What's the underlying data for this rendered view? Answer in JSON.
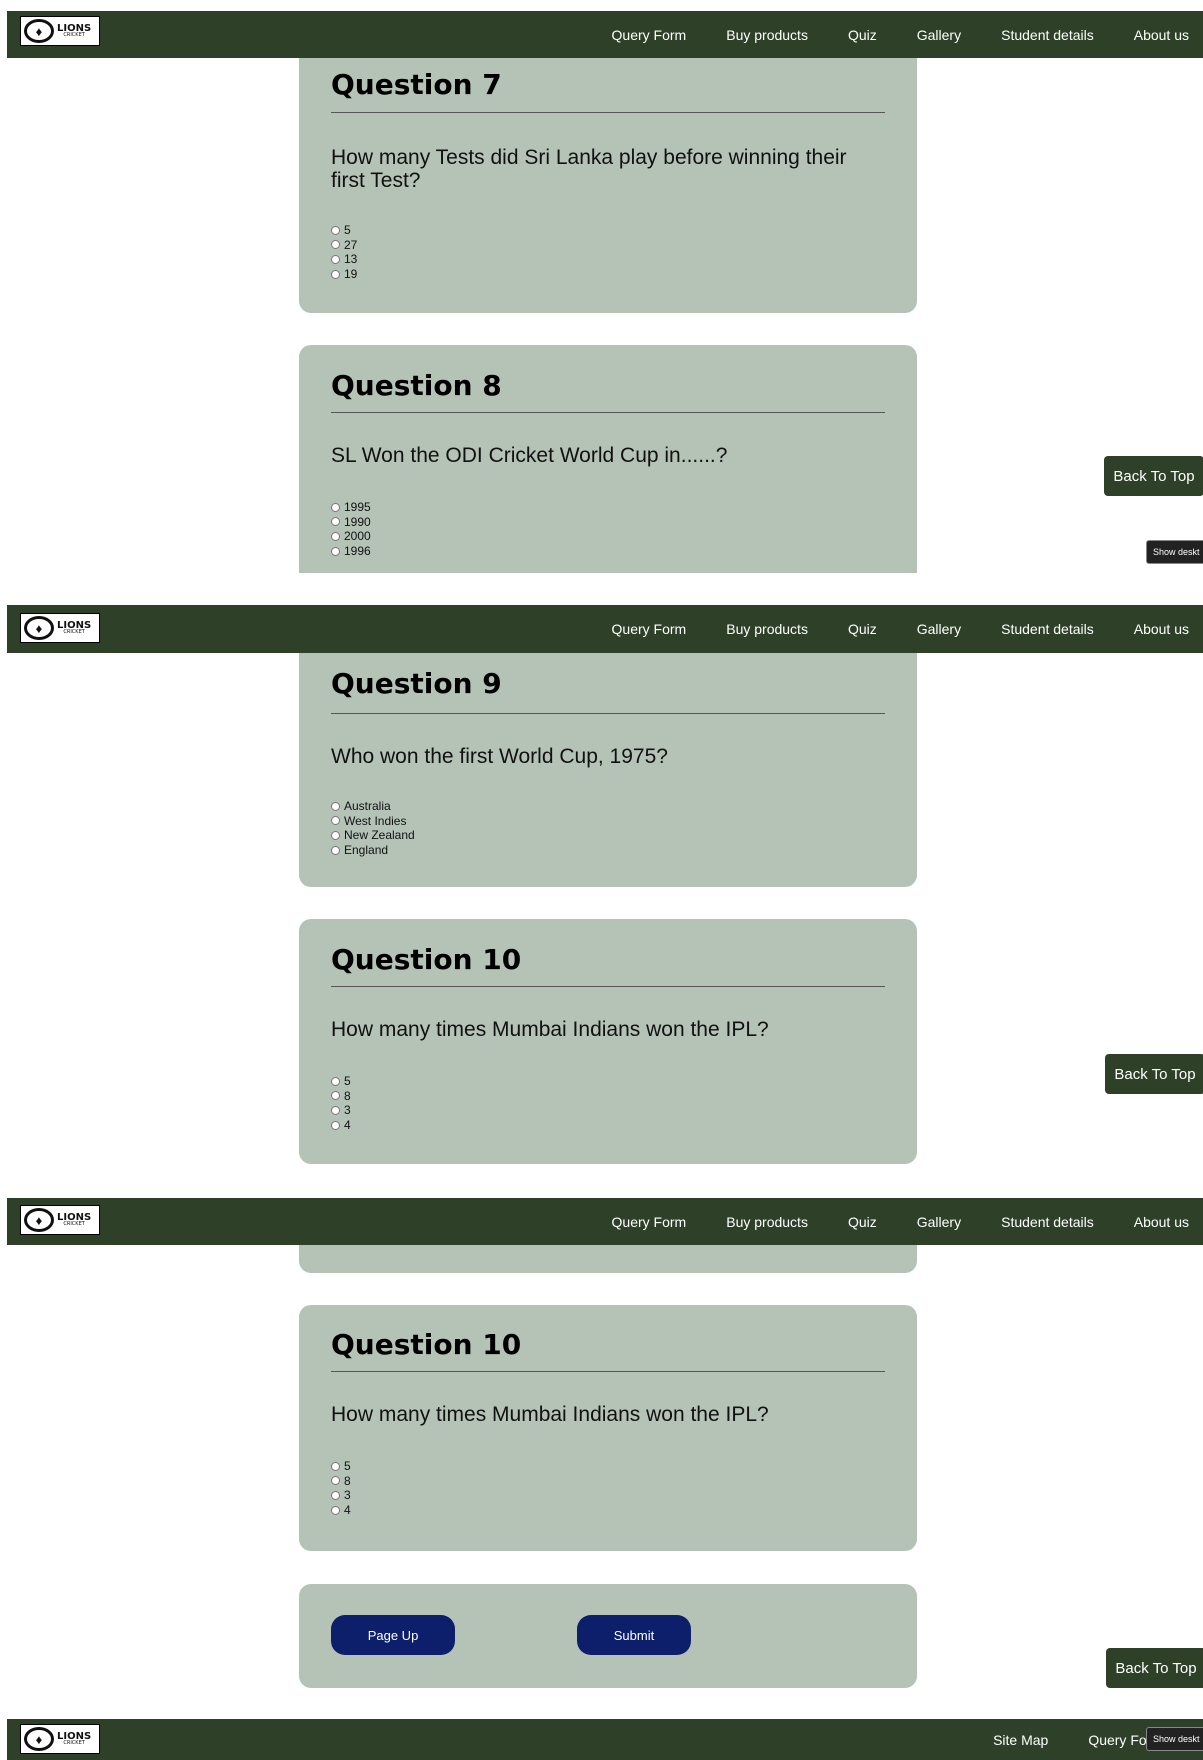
{
  "brand": {
    "logo_text": "LIONS",
    "logo_subtext": "CRICKET"
  },
  "nav": {
    "items": [
      "Query Form",
      "Buy products",
      "Quiz",
      "Gallery",
      "Student details",
      "About us"
    ]
  },
  "back_to_top": "Back To Top",
  "show_desktop": "Show deskt",
  "questions": {
    "q7": {
      "heading": "Question 7",
      "text": "How many Tests did Sri Lanka play before winning their first Test?",
      "options": [
        "5",
        "27",
        "13",
        "19"
      ]
    },
    "q8": {
      "heading": "Question 8",
      "text": "SL Won the ODI Cricket World Cup in......?",
      "options": [
        "1995",
        "1990",
        "2000",
        "1996"
      ]
    },
    "q9": {
      "heading": "Question 9",
      "text": "Who won the first World Cup, 1975?",
      "options": [
        "Australia",
        "West Indies",
        "New Zealand",
        "England"
      ]
    },
    "q10": {
      "heading": "Question 10",
      "text": "How many times Mumbai Indians won the IPL?",
      "options": [
        "5",
        "8",
        "3",
        "4"
      ]
    }
  },
  "actions": {
    "page_up": "Page Up",
    "submit": "Submit"
  },
  "footer": {
    "links": [
      "Site Map",
      "Query Form"
    ],
    "show_desktop": "Show deskt"
  }
}
